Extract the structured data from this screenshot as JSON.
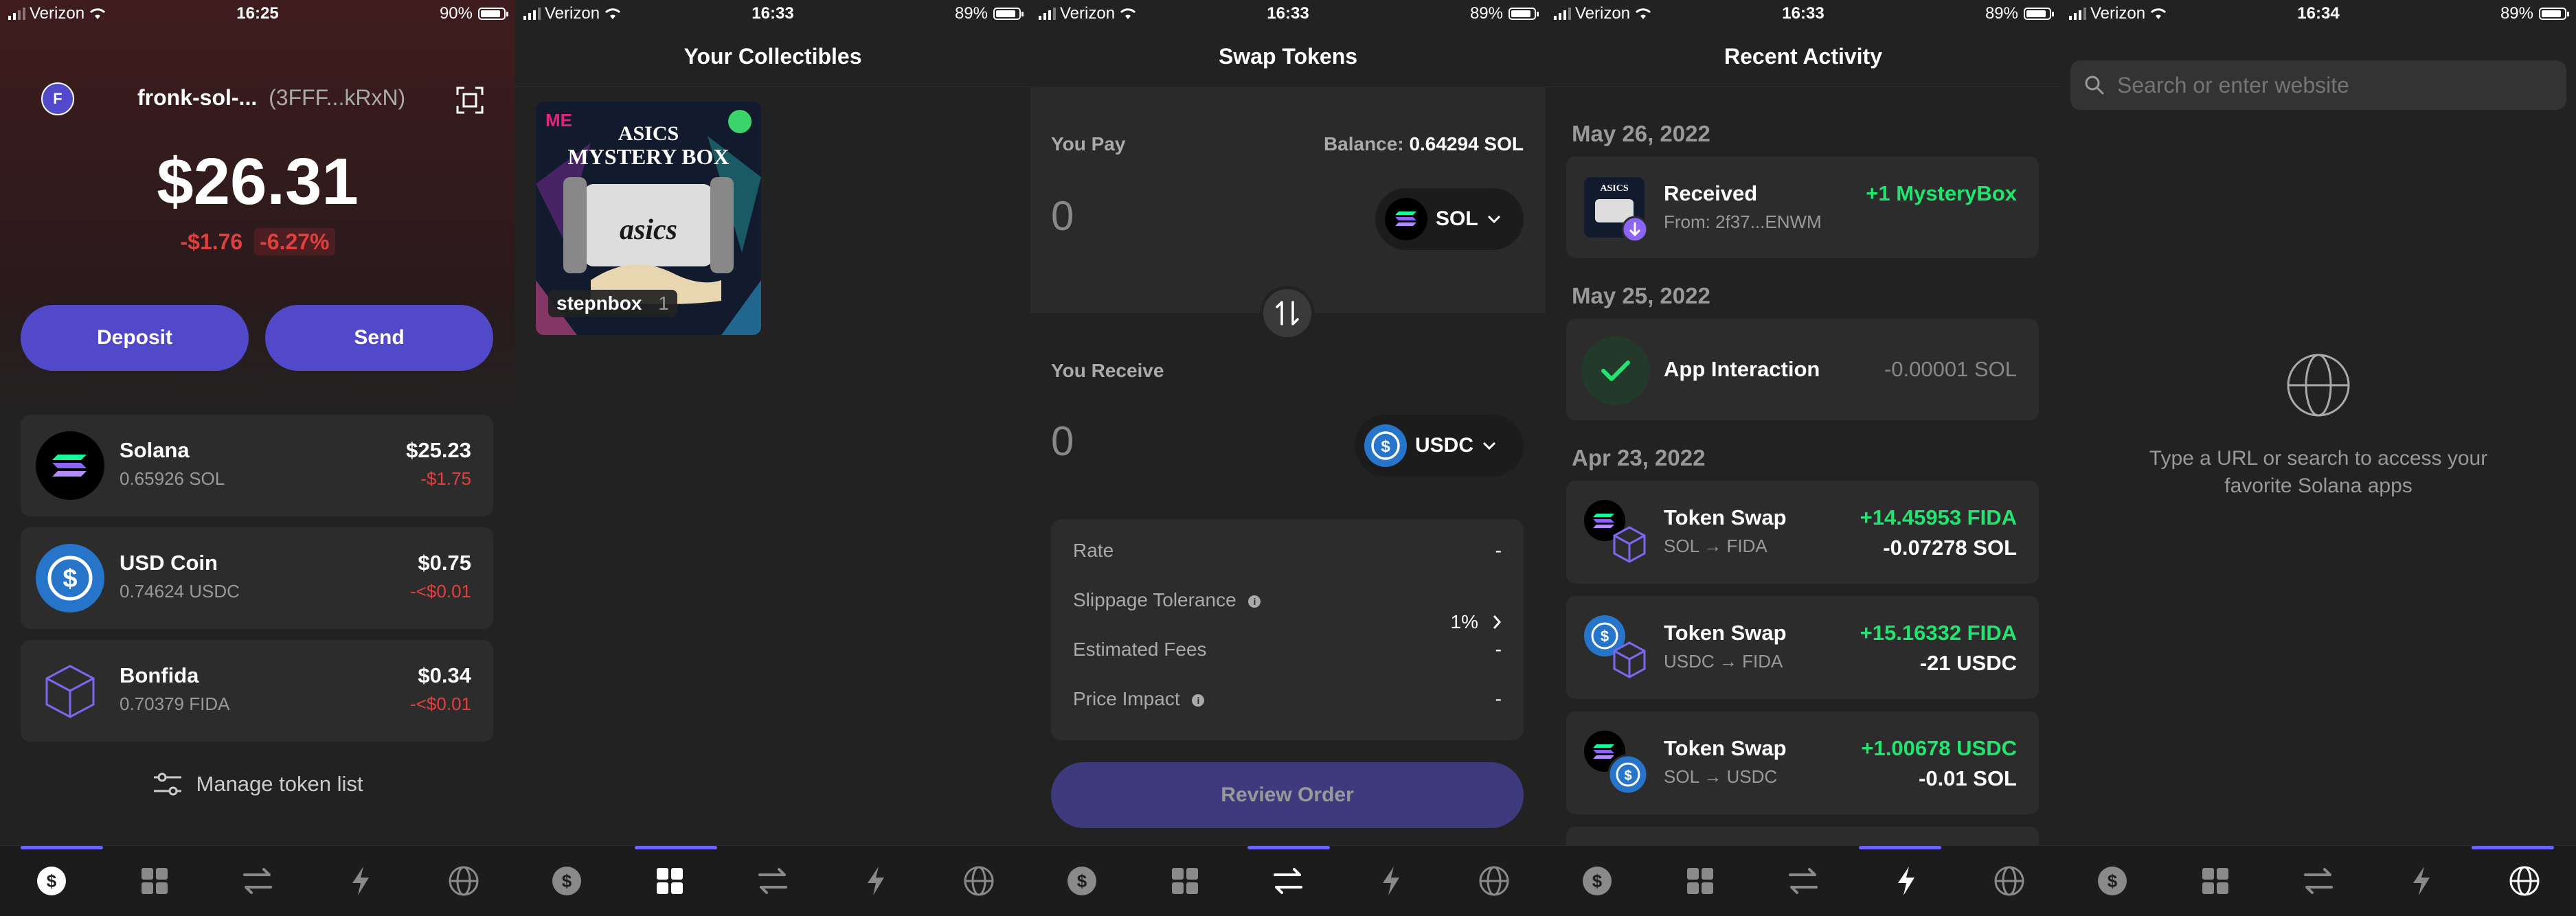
{
  "status": [
    {
      "carrier": "Verizon",
      "time": "16:25",
      "battery": "90%"
    },
    {
      "carrier": "Verizon",
      "time": "16:33",
      "battery": "89%"
    },
    {
      "carrier": "Verizon",
      "time": "16:33",
      "battery": "89%"
    },
    {
      "carrier": "Verizon",
      "time": "16:33",
      "battery": "89%"
    },
    {
      "carrier": "Verizon",
      "time": "16:34",
      "battery": "89%"
    }
  ],
  "wallet": {
    "avatar_letter": "F",
    "account_name": "fronk-sol-...",
    "account_addr": "(3FFF...kRxN)",
    "balance": "$26.31",
    "change_usd": "-$1.76",
    "change_pct": "-6.27%",
    "deposit_label": "Deposit",
    "send_label": "Send",
    "tokens": [
      {
        "name": "Solana",
        "amount": "0.65926 SOL",
        "usd": "$25.23",
        "change": "-$1.75"
      },
      {
        "name": "USD Coin",
        "amount": "0.74624 USDC",
        "usd": "$0.75",
        "change": "-<$0.01"
      },
      {
        "name": "Bonfida",
        "amount": "0.70379 FIDA",
        "usd": "$0.34",
        "change": "-<$0.01"
      }
    ],
    "manage_label": "Manage token list"
  },
  "collectibles": {
    "title": "Your Collectibles",
    "items": [
      {
        "name": "stepnbox",
        "count": "1",
        "art_line1": "ASICS",
        "art_line2": "MYSTERY BOX"
      }
    ]
  },
  "swap": {
    "title": "Swap Tokens",
    "you_pay": "You Pay",
    "balance_label": "Balance:",
    "balance_value": "0.64294 SOL",
    "pay_amount": "0",
    "pay_token": "SOL",
    "you_receive": "You Receive",
    "receive_amount": "0",
    "receive_token": "USDC",
    "details": [
      {
        "label": "Rate",
        "value": "-"
      },
      {
        "label": "Slippage Tolerance",
        "value": "1%"
      },
      {
        "label": "Estimated Fees",
        "value": "-"
      },
      {
        "label": "Price Impact",
        "value": "-"
      }
    ],
    "review_label": "Review Order"
  },
  "activity": {
    "title": "Recent Activity",
    "dates": [
      "May 26, 2022",
      "May 25, 2022",
      "Apr 23, 2022"
    ],
    "items": [
      {
        "title": "Received",
        "sub": "From: 2f37...ENWM",
        "r1": "+1 MysteryBox",
        "r2": ""
      },
      {
        "title": "App Interaction",
        "sub": "",
        "r1": "-0.00001 SOL",
        "r2": ""
      },
      {
        "title": "Token Swap",
        "sub": "SOL → FIDA",
        "r1": "+14.45953 FIDA",
        "r2": "-0.07278 SOL"
      },
      {
        "title": "Token Swap",
        "sub": "USDC → FIDA",
        "r1": "+15.16332 FIDA",
        "r2": "-21 USDC"
      },
      {
        "title": "Token Swap",
        "sub": "SOL → USDC",
        "r1": "+1.00678 USDC",
        "r2": "-0.01 SOL"
      }
    ]
  },
  "browser": {
    "search_placeholder": "Search or enter website",
    "empty_text_1": "Type a URL or search to access your",
    "empty_text_2": "favorite Solana apps"
  },
  "colors": {
    "accent": "#5149c9",
    "positive": "#21e56f",
    "negative": "#e0403f",
    "card": "#2c2c2c"
  },
  "tab_icons": [
    "dollar-icon",
    "grid-icon",
    "swap-arrows-icon",
    "lightning-icon",
    "globe-icon"
  ]
}
